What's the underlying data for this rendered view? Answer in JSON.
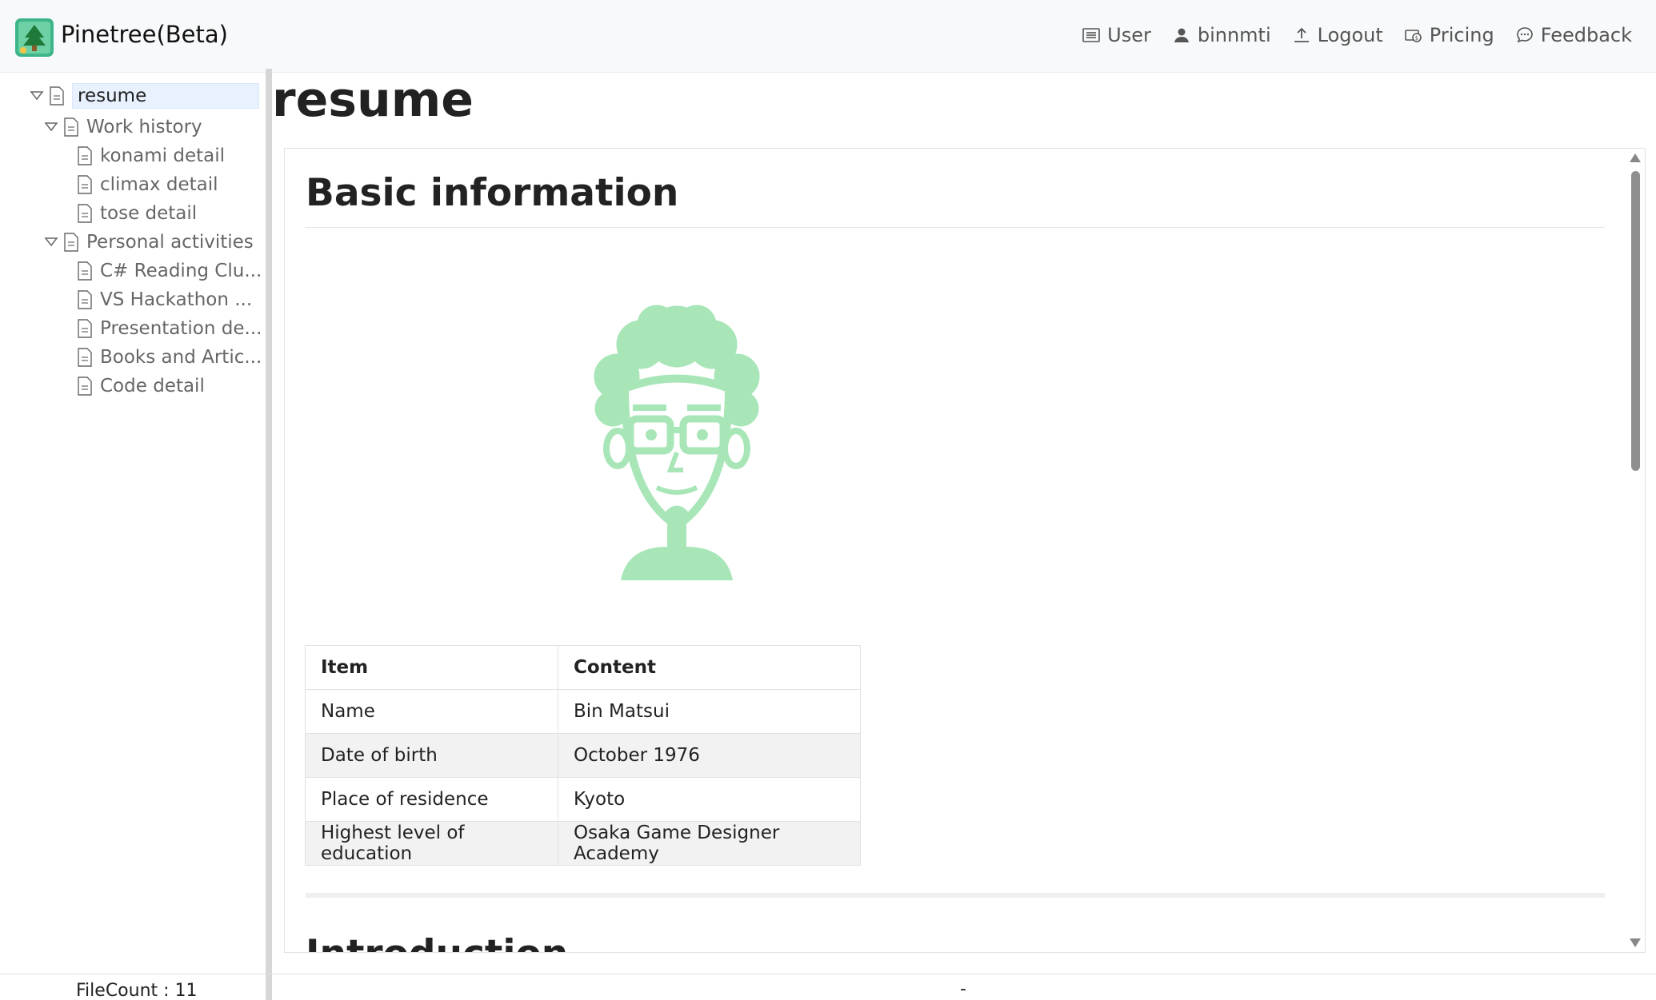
{
  "app": {
    "title": "Pinetree(Beta)"
  },
  "nav": [
    {
      "label": "User",
      "icon": "list-icon"
    },
    {
      "label": "binnmti",
      "icon": "person-icon"
    },
    {
      "label": "Logout",
      "icon": "upload-icon"
    },
    {
      "label": "Pricing",
      "icon": "cash-icon"
    },
    {
      "label": "Feedback",
      "icon": "chat-icon"
    }
  ],
  "tree": {
    "root": "resume",
    "work_history": "Work history",
    "konami": "konami detail",
    "climax": "climax detail",
    "tose": "tose detail",
    "personal": "Personal activities",
    "csharp": "C# Reading Clu...",
    "vs": "VS Hackathon ...",
    "presentation": "Presentation de...",
    "books": "Books and Artic...",
    "code": "Code detail"
  },
  "page": {
    "title": "resume",
    "section1": "Basic information",
    "section2": "Introduction"
  },
  "table": {
    "headers": [
      "Item",
      "Content"
    ],
    "rows": [
      [
        "Name",
        "Bin Matsui"
      ],
      [
        "Date of birth",
        "October 1976"
      ],
      [
        "Place of residence",
        "Kyoto"
      ],
      [
        "Highest level of education",
        "Osaka Game Designer Academy"
      ]
    ]
  },
  "footer": {
    "file_count": "FileCount : 11",
    "status": "-"
  },
  "colors": {
    "accent": "#3eb489",
    "avatar": "#a8e6b8",
    "selected": "#e8f2ff"
  }
}
